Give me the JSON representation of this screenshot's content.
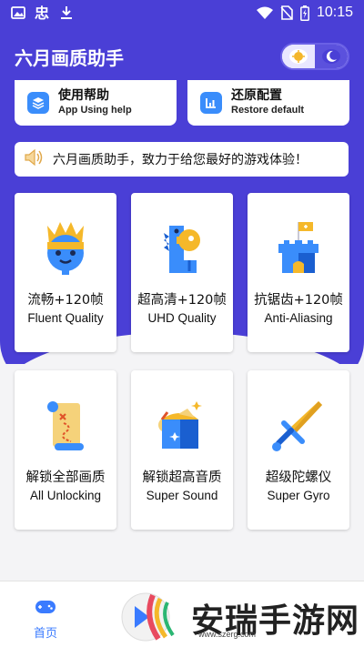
{
  "status_bar": {
    "time": "10:15"
  },
  "app": {
    "title": "六月画质助手"
  },
  "top_cards": [
    {
      "label": "使用帮助",
      "sub": "App Using help",
      "icon": "layers-icon"
    },
    {
      "label": "还原配置",
      "sub": "Restore default",
      "icon": "chart-icon"
    }
  ],
  "notice": {
    "text": "六月画质助手，致力于给您最好的游戏体验！",
    "icon": "speaker-icon"
  },
  "features": [
    {
      "cn": "流畅+120帧",
      "en": "Fluent Quality",
      "icon": "crown-face-icon"
    },
    {
      "cn": "超高清+120帧",
      "en": "UHD Quality",
      "icon": "dino-icon"
    },
    {
      "cn": "抗锯齿+120帧",
      "en": "Anti-Aliasing",
      "icon": "castle-icon"
    },
    {
      "cn": "解锁全部画质",
      "en": "All Unlocking",
      "icon": "scroll-icon"
    },
    {
      "cn": "解锁超高音质",
      "en": "Super Sound",
      "icon": "chest-icon"
    },
    {
      "cn": "超级陀螺仪",
      "en": "Super Gyro",
      "icon": "sword-icon"
    }
  ],
  "nav": {
    "home_label": "首页"
  },
  "watermark": {
    "text": "安瑞手游网",
    "url": "www.szerg.com"
  },
  "colors": {
    "primary": "#4a3fd6",
    "accent": "#3a7bff"
  }
}
